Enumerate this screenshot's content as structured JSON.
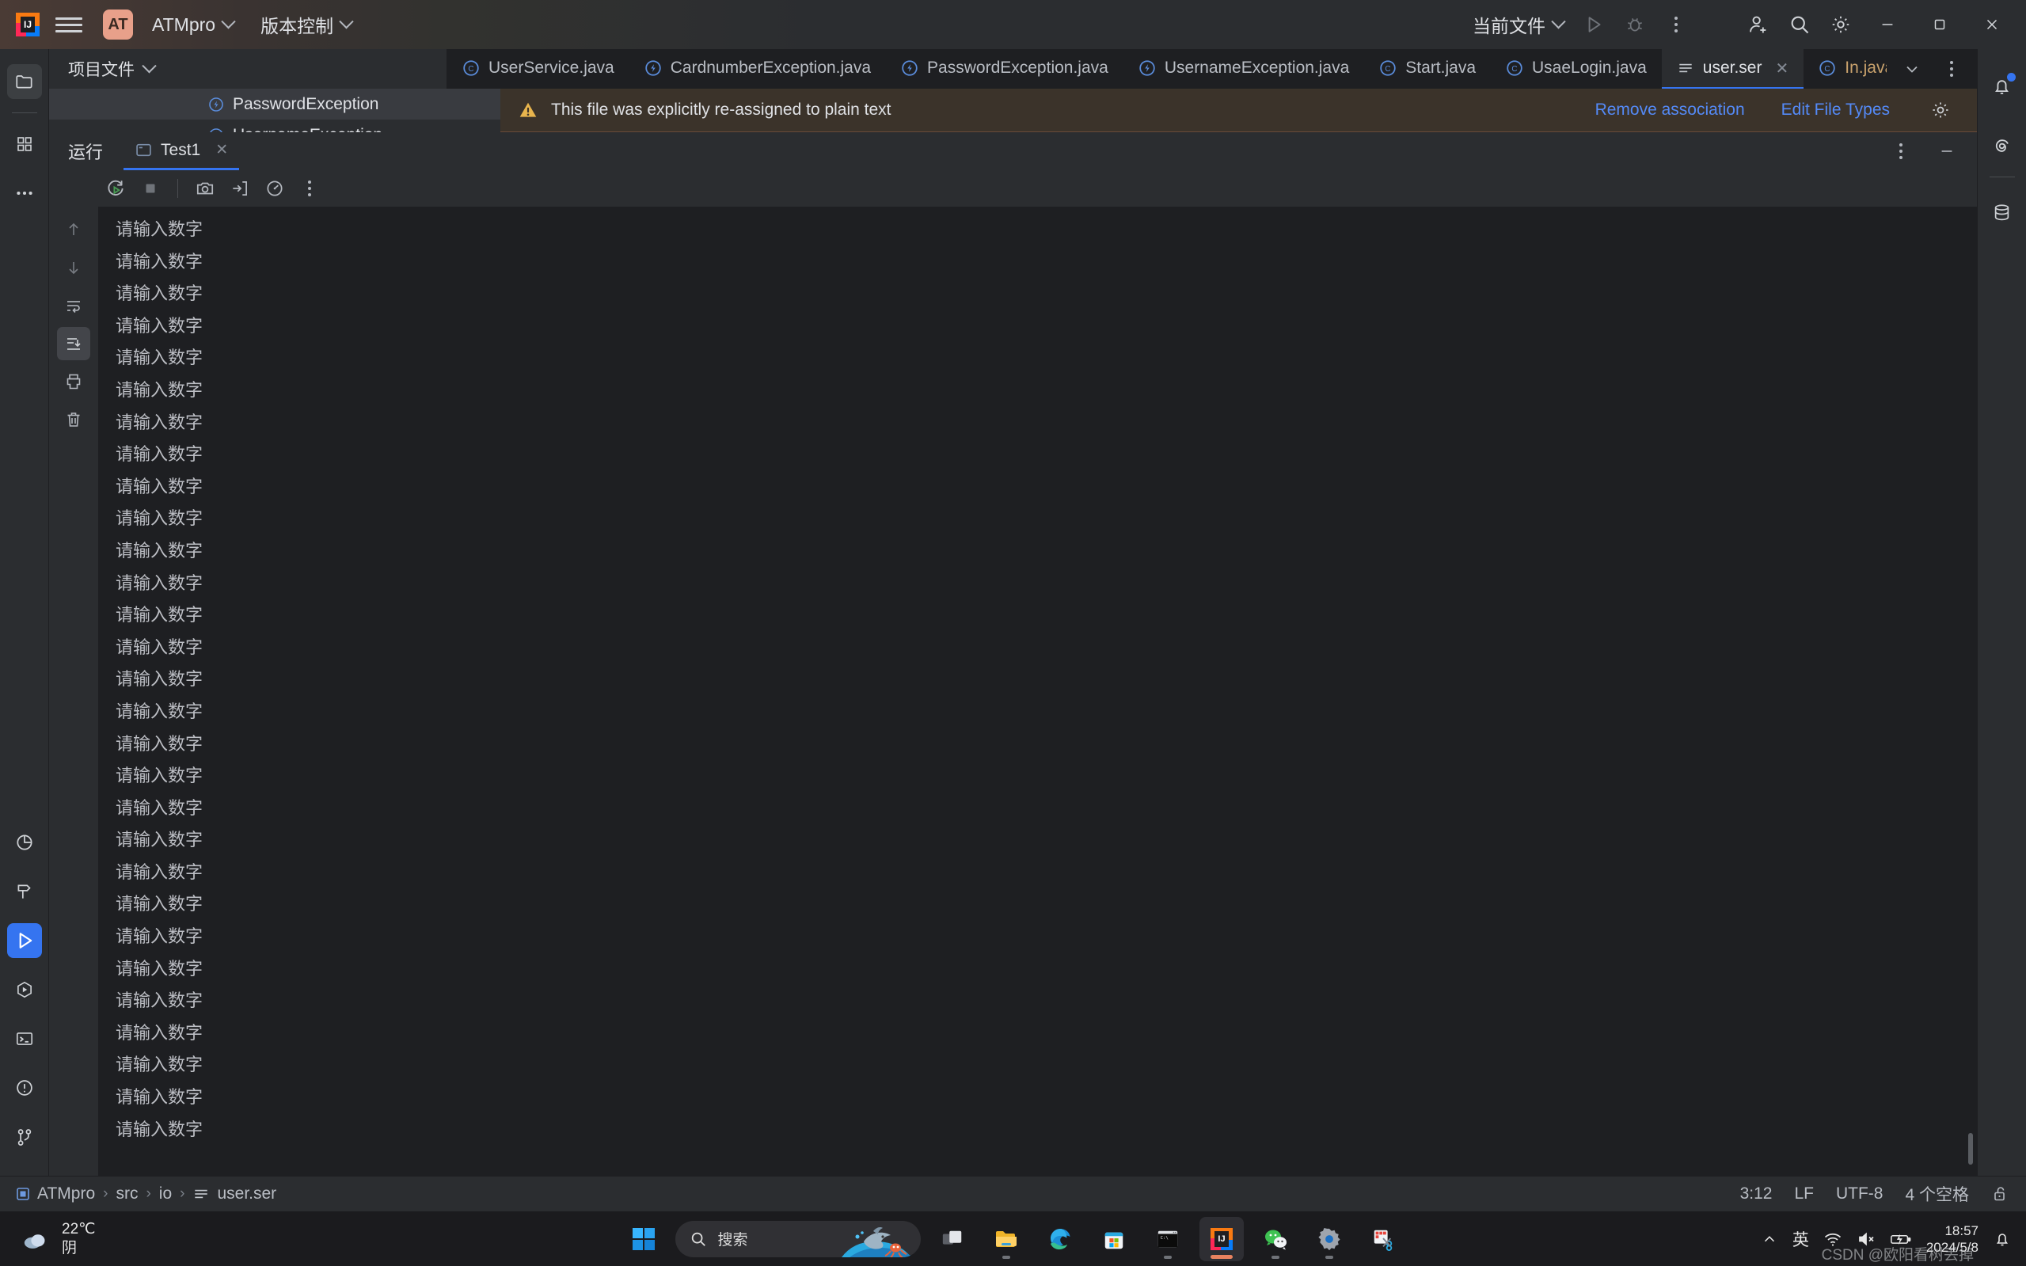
{
  "titlebar": {
    "menu_icon": "hamburger-menu-icon",
    "project_badge": "AT",
    "project_name": "ATMpro",
    "vcs_label": "版本控制",
    "run_config": "当前文件",
    "run_icon": "run-icon",
    "debug_icon": "debug-icon",
    "more_icon": "more-vertical-icon",
    "account_icon": "add-account-icon",
    "search_icon": "search-icon",
    "settings_icon": "gear-icon",
    "minimize": "minimize-icon",
    "maximize": "maximize-icon",
    "close": "close-icon"
  },
  "project_panel": {
    "header": "项目文件",
    "tree_items": [
      {
        "label": "PasswordException",
        "icon": "java-exception-icon",
        "selected": true
      },
      {
        "label": "UsernameException",
        "icon": "java-exception-icon",
        "selected": false
      }
    ]
  },
  "editor_tabs": [
    {
      "label": "UserService.java",
      "icon": "java-class-icon",
      "active": false,
      "modified": false,
      "closable": false
    },
    {
      "label": "CardnumberException.java",
      "icon": "java-exception-icon",
      "active": false,
      "modified": false,
      "closable": false
    },
    {
      "label": "PasswordException.java",
      "icon": "java-exception-icon",
      "active": false,
      "modified": false,
      "closable": false
    },
    {
      "label": "UsernameException.java",
      "icon": "java-exception-icon",
      "active": false,
      "modified": false,
      "closable": false
    },
    {
      "label": "Start.java",
      "icon": "java-class-icon",
      "active": false,
      "modified": false,
      "closable": false
    },
    {
      "label": "UsaeLogin.java",
      "icon": "java-class-icon",
      "active": false,
      "modified": false,
      "closable": false
    },
    {
      "label": "user.ser",
      "icon": "plain-text-icon",
      "active": true,
      "modified": false,
      "closable": true
    },
    {
      "label": "In.java",
      "icon": "java-class-icon",
      "active": false,
      "modified": true,
      "closable": false
    }
  ],
  "tabbar_end": {
    "chevron_icon": "chevron-down-icon",
    "more_icon": "more-vertical-icon"
  },
  "banner": {
    "warning_icon": "warning-triangle-icon",
    "message": "This file was explicitly re-assigned to plain text",
    "actions": [
      "Remove association",
      "Edit File Types"
    ],
    "settings_icon": "gear-icon",
    "bg_color": "#3b332a",
    "link_color": "#548af7"
  },
  "run_window": {
    "title": "运行",
    "tab_label": "Test1",
    "tab_icon": "console-icon",
    "close_icon": "close-icon",
    "options_icon": "more-vertical-icon",
    "hide_icon": "minimize-icon",
    "toolbar": [
      {
        "name": "rerun-icon"
      },
      {
        "name": "stop-icon"
      },
      {
        "name": "screenshot-icon"
      },
      {
        "name": "export-icon"
      },
      {
        "name": "profiler-icon"
      },
      {
        "name": "more-vertical-icon"
      }
    ],
    "gutter": [
      {
        "name": "scroll-up-icon",
        "selected": false
      },
      {
        "name": "scroll-down-icon",
        "selected": false
      },
      {
        "name": "soft-wrap-icon",
        "selected": false
      },
      {
        "name": "scroll-to-end-icon",
        "selected": true
      },
      {
        "name": "print-icon",
        "selected": false
      },
      {
        "name": "clear-all-icon",
        "selected": false
      }
    ],
    "console_line": "请输入数字",
    "console_line_count": 29
  },
  "left_stripe": [
    {
      "name": "project-icon",
      "selected": true,
      "active": false
    },
    {
      "name": "structure-icon",
      "selected": false,
      "active": false
    },
    {
      "name": "more-tools-icon",
      "selected": false,
      "active": false
    },
    {
      "name": "profiler-icon",
      "selected": false,
      "active": false
    },
    {
      "name": "build-icon",
      "selected": false,
      "active": false
    },
    {
      "name": "run-icon",
      "selected": false,
      "active": true
    },
    {
      "name": "debug-icon",
      "selected": false,
      "active": false
    },
    {
      "name": "terminal-icon",
      "selected": false,
      "active": false
    },
    {
      "name": "problems-icon",
      "selected": false,
      "active": false
    },
    {
      "name": "version-control-icon",
      "selected": false,
      "active": false
    }
  ],
  "right_stripe": [
    {
      "name": "notifications-bell-icon",
      "badge": true
    },
    {
      "name": "ai-assistant-icon",
      "badge": false
    },
    {
      "name": "database-icon",
      "badge": false
    }
  ],
  "statusbar": {
    "breadcrumb": [
      {
        "label": "ATMpro",
        "icon": "module-icon"
      },
      {
        "label": "src",
        "icon": ""
      },
      {
        "label": "io",
        "icon": ""
      },
      {
        "label": "user.ser",
        "icon": "plain-text-icon"
      }
    ],
    "caret_position": "3:12",
    "line_separator": "LF",
    "encoding": "UTF-8",
    "indent": "4 个空格",
    "lock_icon": "unlocked-icon"
  },
  "taskbar": {
    "weather": {
      "temperature": "22℃",
      "condition": "阴",
      "icon": "cloud-icon"
    },
    "start_icon": "windows-start-icon",
    "search_placeholder": "搜索",
    "search_icon": "search-icon",
    "items": [
      {
        "name": "task-view-icon",
        "running": false,
        "active": false
      },
      {
        "name": "file-explorer-icon",
        "running": true,
        "active": false
      },
      {
        "name": "edge-browser-icon",
        "running": false,
        "active": false
      },
      {
        "name": "microsoft-store-icon",
        "running": false,
        "active": false
      },
      {
        "name": "terminal-icon",
        "running": true,
        "active": false
      },
      {
        "name": "intellij-idea-icon",
        "running": false,
        "active": true
      },
      {
        "name": "wechat-icon",
        "running": true,
        "active": false
      },
      {
        "name": "settings-icon",
        "running": true,
        "active": false
      },
      {
        "name": "snipping-tool-icon",
        "running": false,
        "active": false
      }
    ],
    "tray": {
      "overflow_icon": "chevron-up-icon",
      "ime": "英",
      "wifi_icon": "wifi-icon",
      "volume_icon": "volume-muted-icon",
      "battery_icon": "battery-charging-icon",
      "time": "18:57",
      "date": "2024/5/8",
      "notification_icon": "bell-icon"
    },
    "watermark": "CSDN @欧阳看树丢掉"
  }
}
